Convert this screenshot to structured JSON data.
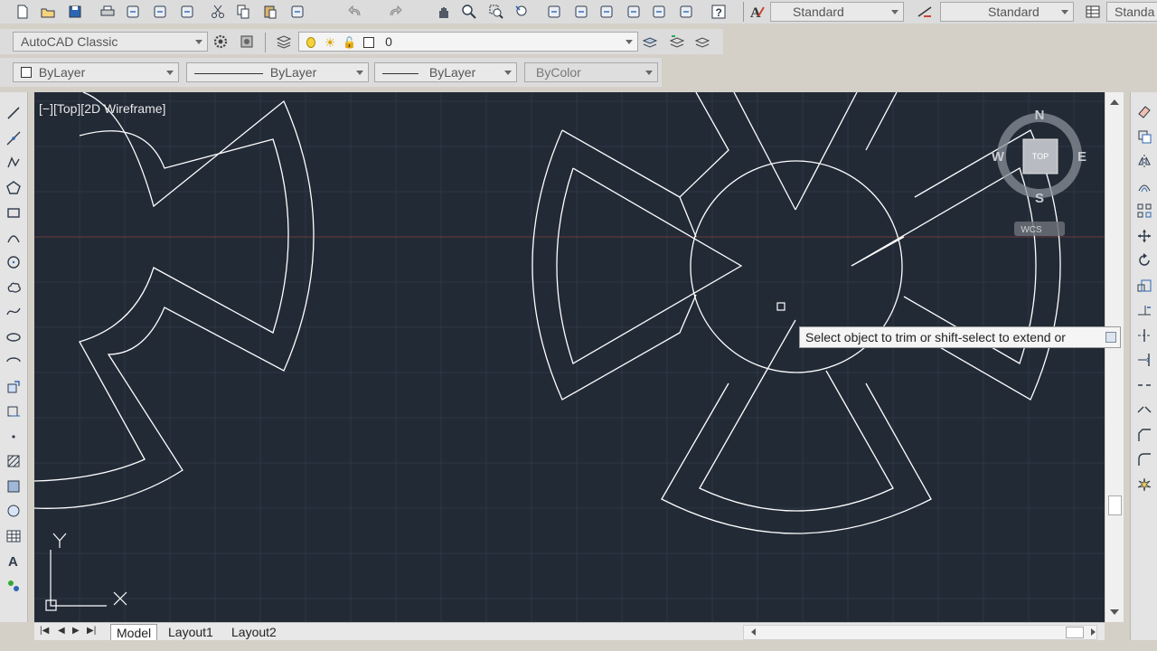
{
  "toolbar_top": {
    "text_style_value": "Standard",
    "dim_style_value": "Standard",
    "table_style_value": "Standa"
  },
  "workspace": {
    "value": "AutoCAD Classic"
  },
  "layer": {
    "value": "0"
  },
  "properties": {
    "color": "ByLayer",
    "linetype": "ByLayer",
    "lineweight": "ByLayer",
    "plotstyle": "ByColor"
  },
  "viewport": {
    "label": "[−][Top][2D Wireframe]",
    "background": "#222a36",
    "grid_color": "#2e3746",
    "line_color": "#ffffff"
  },
  "viewcube": {
    "north": "N",
    "south": "S",
    "east": "E",
    "west": "W",
    "face": "TOP",
    "ucs": "WCS"
  },
  "ucs_icon": {
    "x": "X",
    "y": "Y"
  },
  "command_tooltip": {
    "text": "Select object to trim or shift-select to extend or"
  },
  "tabs": [
    {
      "label": "Model"
    },
    {
      "label": "Layout1"
    },
    {
      "label": "Layout2"
    }
  ],
  "icons": {
    "top": [
      "new-icon",
      "open-icon",
      "save-icon",
      "plot-icon",
      "plot-preview-icon",
      "publish-icon",
      "3d-dwf-icon",
      "cut-icon",
      "copy-icon",
      "paste-icon",
      "match-properties-icon",
      "undo-icon",
      "redo-icon",
      "pan-icon",
      "zoom-realtime-icon",
      "zoom-window-icon",
      "zoom-previous-icon",
      "properties-icon",
      "design-center-icon",
      "tool-palettes-icon",
      "sheet-set-icon",
      "markup-icon",
      "calculator-icon",
      "help-icon",
      "text-style-icon",
      "dim-style-icon",
      "table-style-icon"
    ],
    "left": [
      "line-icon",
      "construction-line-icon",
      "polyline-icon",
      "polygon-icon",
      "rectangle-icon",
      "arc-icon",
      "circle-icon",
      "revision-cloud-icon",
      "spline-icon",
      "ellipse-icon",
      "ellipse-arc-icon",
      "insert-block-icon",
      "make-block-icon",
      "point-icon",
      "hatch-icon",
      "gradient-icon",
      "region-icon",
      "table-icon",
      "multiline-text-icon",
      "add-selected-icon"
    ],
    "right": [
      "erase-icon",
      "copy-object-icon",
      "mirror-icon",
      "offset-icon",
      "array-icon",
      "move-icon",
      "rotate-icon",
      "scale-icon",
      "stretch-icon",
      "trim-icon",
      "extend-icon",
      "break-icon",
      "join-icon",
      "chamfer-icon",
      "fillet-icon",
      "explode-icon"
    ]
  }
}
